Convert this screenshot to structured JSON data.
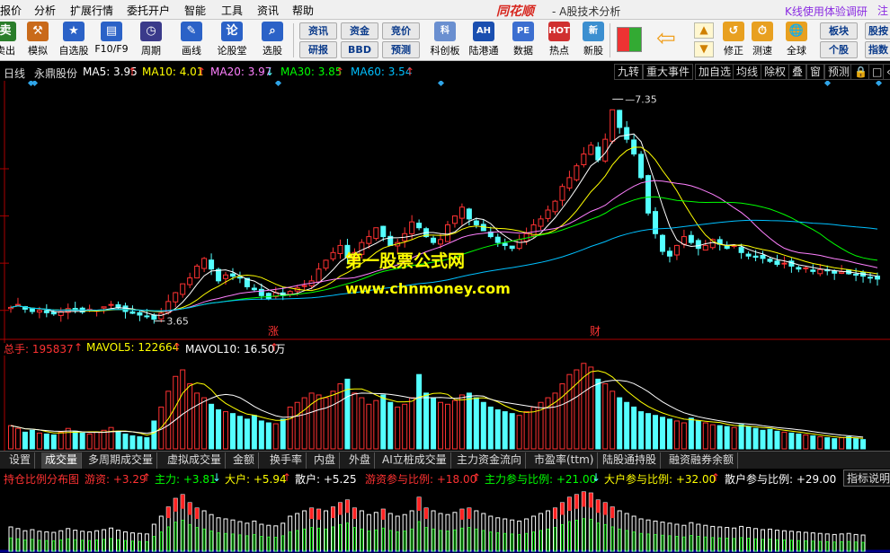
{
  "menu": {
    "items": [
      "报价",
      "分析",
      "扩展行情",
      "委托开户",
      "智能",
      "工具",
      "资讯",
      "帮助"
    ],
    "brand": "同花顺",
    "subtitle": "- A股技术分析",
    "promo": "K线使用体验调研",
    "promo_tail": "注"
  },
  "toolbar": {
    "buttons": [
      {
        "label": "卖出",
        "icon": "卖"
      },
      {
        "label": "模拟",
        "icon": "gavel-icon"
      },
      {
        "label": "自选股",
        "icon": "star-icon"
      },
      {
        "label": "F10/F9",
        "icon": "f10-icon"
      },
      {
        "label": "周期",
        "icon": "clock-icon"
      },
      {
        "label": "画线",
        "icon": "pen-icon"
      },
      {
        "label": "论股堂",
        "icon": "论"
      },
      {
        "label": "选股",
        "icon": "search-icon"
      }
    ],
    "small": [
      "资讯",
      "资金",
      "竞价",
      "研报",
      "BBD",
      "预测"
    ],
    "buttons2": [
      {
        "label": "科创板",
        "icon": "科"
      },
      {
        "label": "陆港通",
        "icon": "AH"
      },
      {
        "label": "数据",
        "icon": "PE"
      },
      {
        "label": "热点",
        "icon": "HOT"
      },
      {
        "label": "新股",
        "icon": "新"
      }
    ],
    "buttons3": [
      {
        "label": "修正",
        "icon": "↺"
      },
      {
        "label": "测速",
        "icon": "⏱"
      },
      {
        "label": "全球",
        "icon": "🌐"
      }
    ],
    "small2": [
      "板块",
      "个股"
    ],
    "tail": [
      "股按",
      "指数"
    ]
  },
  "header": {
    "period": "日线",
    "stock": "永鼎股份",
    "ma5": "MA5: 3.95",
    "ma10": "MA10: 4.01",
    "ma20": "MA20: 3.97",
    "ma30": "MA30: 3.85",
    "ma60": "MA60: 3.54",
    "right_tabs": [
      "九转",
      "重大事件",
      "加自选",
      "均线",
      "除权",
      "叠",
      "窗",
      "预测",
      "🔒",
      "□",
      "‹"
    ]
  },
  "annotations": {
    "high": "7.35",
    "low": "3.65",
    "mark1": "涨",
    "mark2": "财"
  },
  "watermark": {
    "line1": "第一股票公式网",
    "line2": "www.chnmoney.com"
  },
  "volume_header": {
    "total": "总手: 195837",
    "mavol5": "MAVOL5: 122664",
    "mavol10": "MAVOL10: 16.50万"
  },
  "indicator_tabs": [
    "设置",
    "成交量",
    "多周期成交量",
    "虚拟成交量",
    "金额",
    "换手率",
    "内盘",
    "外盘",
    "AI立桩成交量",
    "主力资金流向",
    "市盈率(ttm)",
    "陆股通持股",
    "融资融券余额"
  ],
  "bottom_header": {
    "title": "持仓比例分布图",
    "youzi": "游资: +3.29",
    "zhuli": "主力: +3.81",
    "dahu": "大户: +5.94",
    "sanhu": "散户: +5.25",
    "youzi_ratio": "游资参与比例: +18.00",
    "zhuli_ratio": "主力参与比例: +21.00",
    "dahu_ratio": "大户参与比例: +32.00",
    "sanhu_ratio": "散户参与比例: +29.00",
    "help": "指标说明"
  },
  "colors": {
    "up": "#ff3232",
    "down": "#54ffff",
    "ma5": "#ffffff",
    "ma10": "#ffff00",
    "ma20": "#ff80ff",
    "ma30": "#00ff00",
    "ma60": "#00c0ff"
  },
  "chart_data": {
    "type": "candlestick",
    "title": "永鼎股份 日线",
    "price_range": [
      3.4,
      7.6
    ],
    "high_label": 7.35,
    "low_label": 3.65,
    "series": [
      {
        "name": "MA5",
        "value": 3.95
      },
      {
        "name": "MA10",
        "value": 4.01
      },
      {
        "name": "MA20",
        "value": 3.97
      },
      {
        "name": "MA30",
        "value": 3.85
      },
      {
        "name": "MA60",
        "value": 3.54
      }
    ],
    "closes": [
      3.85,
      3.9,
      3.82,
      3.78,
      3.8,
      3.76,
      3.74,
      3.78,
      3.83,
      3.8,
      3.77,
      3.82,
      3.8,
      3.86,
      3.9,
      3.84,
      3.78,
      3.75,
      3.72,
      3.7,
      3.65,
      3.75,
      3.95,
      4.1,
      4.25,
      4.35,
      4.55,
      4.68,
      4.5,
      4.3,
      4.4,
      4.38,
      4.35,
      4.2,
      4.15,
      4.05,
      4.0,
      4.1,
      4.05,
      4.12,
      4.18,
      4.22,
      4.3,
      4.5,
      4.65,
      4.78,
      4.9,
      4.7,
      4.78,
      4.95,
      5.05,
      5.2,
      5.05,
      4.9,
      4.95,
      5.1,
      5.3,
      5.2,
      5.05,
      4.95,
      5.0,
      5.25,
      5.4,
      5.55,
      5.35,
      5.25,
      5.15,
      5.05,
      4.95,
      4.9,
      4.85,
      5.0,
      5.1,
      5.25,
      5.35,
      5.5,
      5.65,
      5.9,
      6.05,
      6.25,
      6.45,
      6.6,
      6.35,
      6.7,
      7.2,
      6.9,
      6.7,
      6.45,
      6.05,
      5.45,
      5.1,
      4.8,
      4.72,
      4.9,
      5.05,
      4.95,
      4.85,
      4.9,
      5.0,
      4.92,
      4.85,
      4.9,
      4.78,
      4.72,
      4.7,
      4.68,
      4.63,
      4.58,
      4.6,
      4.55,
      4.5,
      4.52,
      4.46,
      4.49,
      4.47,
      4.43,
      4.45,
      4.42,
      4.4,
      4.38,
      4.36,
      4.33
    ]
  },
  "volume_data": {
    "type": "bar",
    "values": [
      25,
      22,
      18,
      20,
      17,
      16,
      15,
      18,
      22,
      19,
      17,
      16,
      18,
      20,
      23,
      19,
      16,
      14,
      13,
      12,
      30,
      45,
      62,
      78,
      85,
      70,
      60,
      55,
      48,
      42,
      40,
      38,
      35,
      32,
      36,
      30,
      28,
      27,
      32,
      45,
      50,
      55,
      60,
      58,
      55,
      62,
      70,
      75,
      60,
      55,
      48,
      52,
      58,
      50,
      45,
      48,
      55,
      80,
      60,
      55,
      50,
      48,
      52,
      58,
      60,
      55,
      50,
      45,
      42,
      40,
      38,
      36,
      40,
      45,
      50,
      55,
      60,
      70,
      80,
      85,
      92,
      88,
      75,
      70,
      62,
      55,
      50,
      45,
      40,
      38,
      36,
      34,
      32,
      30,
      28,
      33,
      30,
      28,
      26,
      25,
      24,
      23,
      26,
      24,
      22,
      20,
      21,
      19,
      18,
      17,
      16,
      15,
      14,
      13,
      12,
      11,
      12,
      13,
      11,
      10
    ]
  }
}
